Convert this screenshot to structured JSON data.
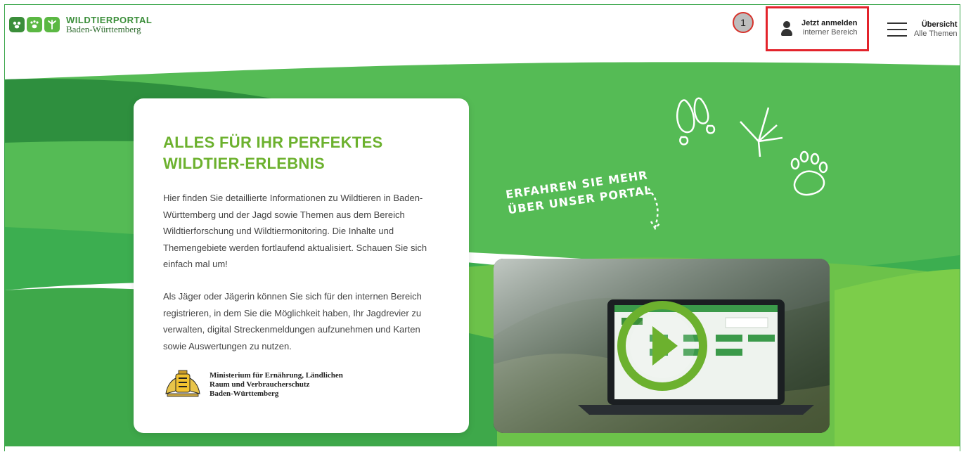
{
  "header": {
    "logo_title": "WILDTIERPORTAL",
    "logo_subtitle": "Baden-Württemberg",
    "step_marker": "1",
    "login_title": "Jetzt anmelden",
    "login_subtitle": "interner Bereich",
    "menu_title": "Übersicht",
    "menu_subtitle": "Alle Themen"
  },
  "hero": {
    "title_line1": "ALLES FÜR IHR PERFEKTES",
    "title_line2": "WILDTIER-ERLEBNIS",
    "paragraph1": "Hier finden Sie detaillierte Informationen zu Wildtieren in Baden-Württemberg und der Jagd sowie Themen aus dem Bereich Wildtierforschung und Wildtiermonitoring. Die Inhalte und Themengebiete werden fortlaufend aktualisiert. Schauen Sie sich einfach mal um!",
    "paragraph2": "Als Jäger oder Jägerin können Sie sich für den internen Bereich registrieren, in dem Sie die Möglichkeit haben, Ihr Jagdrevier zu verwalten, digital Streckenmeldungen aufzunehmen und Karten sowie Auswertungen zu nutzen.",
    "ministry_line1": "Ministerium für Ernährung, Ländlichen",
    "ministry_line2": "Raum und Verbraucherschutz",
    "ministry_line3": "Baden-Württemberg",
    "handwritten_line1": "ERFAHREN SIE MEHR",
    "handwritten_line2": "ÜBER UNSER PORTAL"
  },
  "icons": {
    "logo_icons": [
      "paw-leaf-icon",
      "paw-icon",
      "bird-track-icon"
    ],
    "login_icon": "user-icon",
    "menu_icon": "hamburger-icon",
    "play_icon": "play-icon"
  },
  "colors": {
    "brand_green": "#3b8e3a",
    "accent_green": "#6cb12e",
    "hero_green": "#55bb55",
    "highlight_red": "#e3232b"
  }
}
